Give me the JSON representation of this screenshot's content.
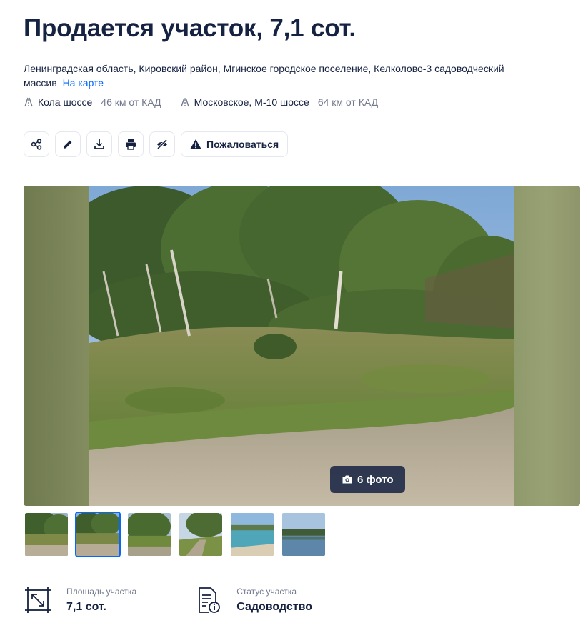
{
  "title": "Продается участок, 7,1 сот.",
  "address": {
    "text": "Ленинградская область, Кировский район, Мгинское городское поселение, Келколово-3 садоводческий массив",
    "map_link": "На карте"
  },
  "highways": [
    {
      "name": "Кола шоссе",
      "distance": "46 км от КАД",
      "icon": "highway-icon"
    },
    {
      "name": "Московское, М-10 шоссе",
      "distance": "64 км от КАД",
      "icon": "highway-icon"
    }
  ],
  "actions": {
    "buttons": [
      {
        "name": "share-button",
        "icon": "share-icon"
      },
      {
        "name": "edit-button",
        "icon": "pencil-icon"
      },
      {
        "name": "download-button",
        "icon": "download-icon"
      },
      {
        "name": "print-button",
        "icon": "printer-icon"
      },
      {
        "name": "hide-button",
        "icon": "eye-off-icon"
      }
    ],
    "complain_label": "Пожаловаться",
    "complain_icon": "warning-icon"
  },
  "gallery": {
    "photo_count_label": "6 фото",
    "camera_icon": "camera-icon",
    "thumbnails_count": 6,
    "active_thumbnail": 2
  },
  "features": [
    {
      "label": "Площадь участка",
      "value": "7,1 сот.",
      "icon": "area-icon"
    },
    {
      "label": "Статус участка",
      "value": "Садоводство",
      "icon": "document-info-icon"
    }
  ],
  "colors": {
    "text_primary": "#152242",
    "text_secondary": "#737a8e",
    "link": "#0468ff",
    "border": "#e4e7ee"
  }
}
